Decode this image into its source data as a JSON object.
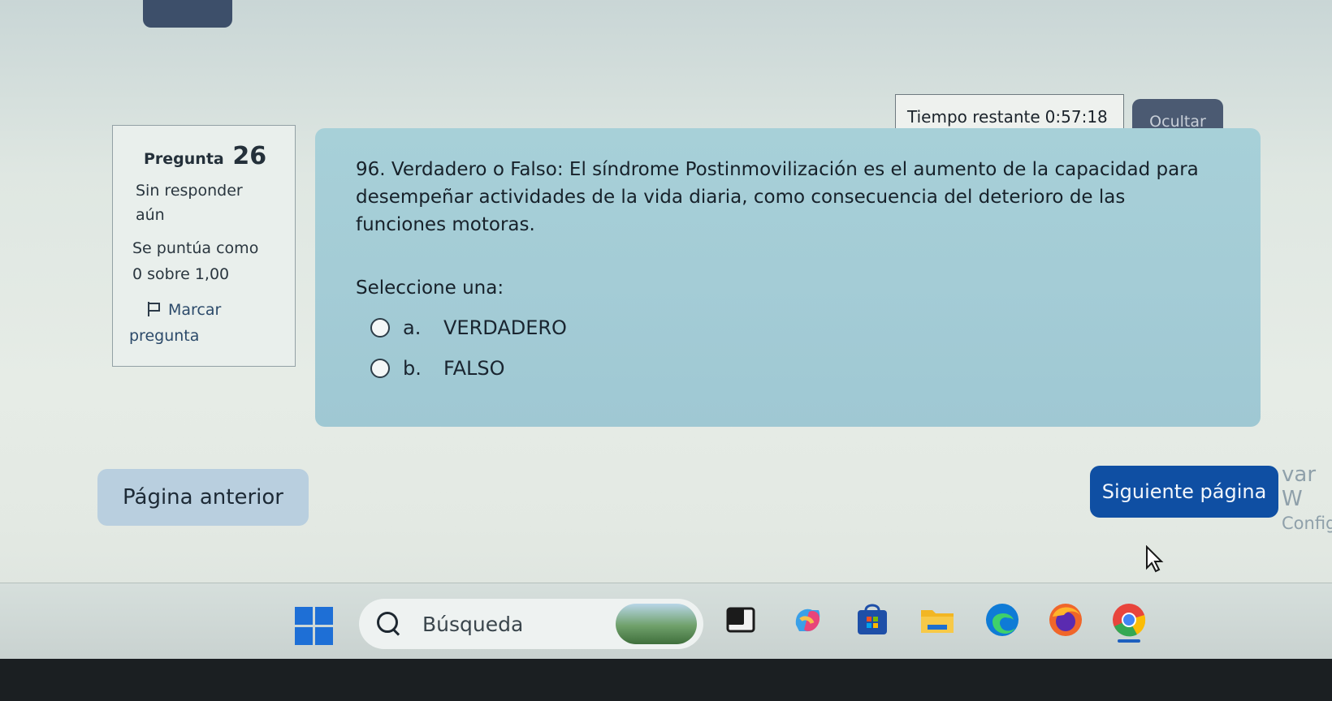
{
  "quiz": {
    "timer_label": "Tiempo restante",
    "timer_value": "0:57:18",
    "hide_label": "Ocultar",
    "info": {
      "question_word": "Pregunta",
      "question_number": "26",
      "status_line1": "Sin responder",
      "status_line2": "aún",
      "grade_line1": "Se puntúa como",
      "grade_line2": "0 sobre 1,00",
      "flag_line1": "Marcar",
      "flag_line2": "pregunta"
    },
    "question_text": "96. Verdadero o Falso: El síndrome Postinmovilización es el aumento de la capacidad para desempeñar actividades de la vida diaria, como consecuencia del deterioro de las funciones motoras.",
    "prompt": "Seleccione una:",
    "options": [
      {
        "letter": "a.",
        "text": "VERDADERO"
      },
      {
        "letter": "b.",
        "text": "FALSO"
      }
    ],
    "prev_label": "Página anterior",
    "next_label": "Siguiente página"
  },
  "overlay": {
    "activate_line1": "var W",
    "activate_line2": "Config"
  },
  "taskbar": {
    "search_placeholder": "Búsqueda",
    "icons": [
      "windows-start",
      "task-view",
      "copilot",
      "store",
      "file-explorer",
      "edge",
      "firefox",
      "chrome"
    ],
    "accent_color": "#1e6fd6"
  }
}
